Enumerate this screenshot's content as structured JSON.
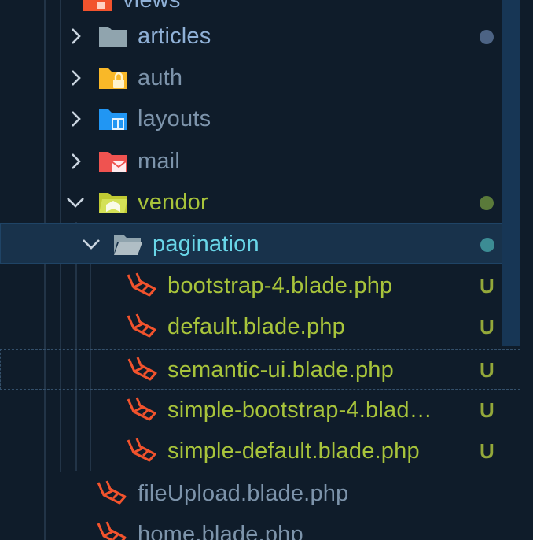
{
  "explorer": {
    "colors": {
      "background": "#0f1c2a",
      "folder_text": "#8fb0d6",
      "muted_text": "#7d94ab",
      "vendor_text": "#a8c43b",
      "pagination_text": "#69d6e8",
      "file_text": "#a8c43b",
      "untracked_badge": "#93a83a",
      "laravel_icon": "#f2532d"
    },
    "top_partial": {
      "label": "views"
    },
    "rows": [
      {
        "label": "articles",
        "type": "folder",
        "expanded": false,
        "icon": "folder-icon",
        "decoration": "dot"
      },
      {
        "label": "auth",
        "type": "folder",
        "expanded": false,
        "icon": "folder-lock-icon",
        "decoration": ""
      },
      {
        "label": "layouts",
        "type": "folder",
        "expanded": false,
        "icon": "folder-layout-icon",
        "decoration": ""
      },
      {
        "label": "mail",
        "type": "folder",
        "expanded": false,
        "icon": "folder-mail-icon",
        "decoration": ""
      },
      {
        "label": "vendor",
        "type": "folder",
        "expanded": true,
        "icon": "folder-vendor-icon",
        "decoration": "dot"
      },
      {
        "label": "pagination",
        "type": "folder",
        "expanded": true,
        "icon": "folder-open-icon",
        "decoration": "dot"
      },
      {
        "label": "bootstrap-4.blade.php",
        "type": "file",
        "icon": "laravel-icon",
        "badge": "U"
      },
      {
        "label": "default.blade.php",
        "type": "file",
        "icon": "laravel-icon",
        "badge": "U"
      },
      {
        "label": "semantic-ui.blade.php",
        "type": "file",
        "icon": "laravel-icon",
        "badge": "U"
      },
      {
        "label": "simple-bootstrap-4.blad…",
        "type": "file",
        "icon": "laravel-icon",
        "badge": "U"
      },
      {
        "label": "simple-default.blade.php",
        "type": "file",
        "icon": "laravel-icon",
        "badge": "U"
      },
      {
        "label": "fileUpload.blade.php",
        "type": "file",
        "icon": "laravel-icon",
        "badge": ""
      },
      {
        "label": "home.blade.php",
        "type": "file",
        "icon": "laravel-icon",
        "badge": ""
      }
    ]
  }
}
